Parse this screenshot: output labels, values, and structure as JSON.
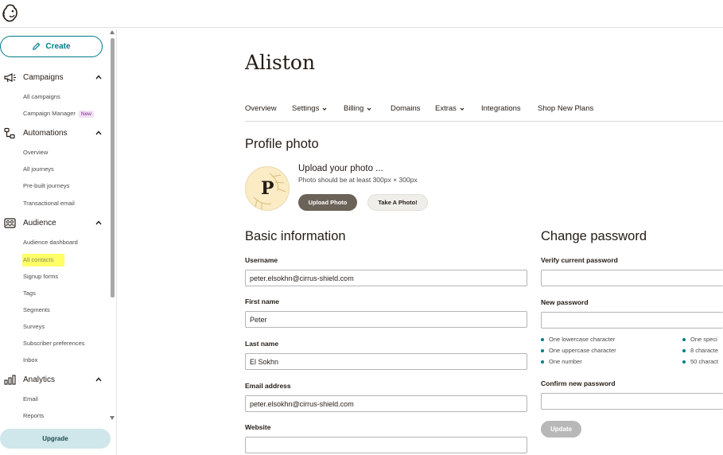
{
  "sidebar": {
    "create_label": "Create",
    "sections": [
      {
        "label": "Campaigns",
        "icon": "megaphone-icon",
        "items": [
          "All campaigns",
          "Campaign Manager"
        ],
        "badge": "New"
      },
      {
        "label": "Automations",
        "icon": "automation-icon",
        "items": [
          "Overview",
          "All journeys",
          "Pre-built journeys",
          "Transactional email"
        ]
      },
      {
        "label": "Audience",
        "icon": "audience-icon",
        "items": [
          "Audience dashboard",
          "All contacts",
          "Signup forms",
          "Tags",
          "Segments",
          "Surveys",
          "Subscriber preferences",
          "Inbox"
        ]
      },
      {
        "label": "Analytics",
        "icon": "bar-chart-icon",
        "items": [
          "Email",
          "Reports"
        ]
      }
    ],
    "upgrade_label": "Upgrade"
  },
  "account_name": "Aliston",
  "tabs": [
    "Overview",
    "Settings",
    "Billing",
    "Domains",
    "Extras",
    "Integrations",
    "Shop New Plans"
  ],
  "profile_photo": {
    "heading": "Profile photo",
    "avatar_initial": "P",
    "upload_title": "Upload your photo ...",
    "upload_hint": "Photo should be at least 300px × 300px",
    "upload_button": "Upload Photo",
    "take_button": "Take A Photo!"
  },
  "basic_info": {
    "heading": "Basic information",
    "fields": [
      {
        "label": "Username",
        "value": "peter.elsokhn@cirrus-shield.com"
      },
      {
        "label": "First name",
        "value": "Peter"
      },
      {
        "label": "Last name",
        "value": "El Sokhn"
      },
      {
        "label": "Email address",
        "value": "peter.elsokhn@cirrus-shield.com"
      },
      {
        "label": "Website",
        "value": ""
      }
    ]
  },
  "change_password": {
    "heading": "Change password",
    "verify_label": "Verify current password",
    "new_label": "New password",
    "requirements_left": [
      "One lowercase character",
      "One uppercase character",
      "One number"
    ],
    "requirements_right": [
      "One speci",
      "8 characte",
      "50 charact"
    ],
    "confirm_label": "Confirm new password",
    "update_button": "Update"
  },
  "colors": {
    "accent": "#007c89",
    "highlight": "#ffff66"
  }
}
